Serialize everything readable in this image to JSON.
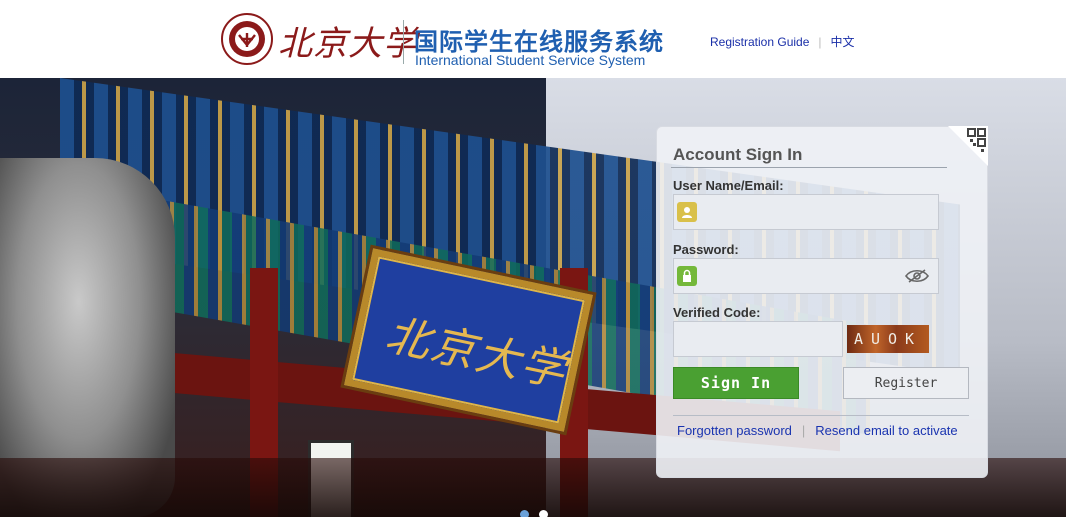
{
  "header": {
    "logo_script": "北京大学",
    "system_title_cn": "国际学生在线服务系统",
    "system_title_en": "International Student Service System",
    "links": [
      {
        "label": "Registration Guide"
      },
      {
        "label": "中文"
      }
    ]
  },
  "hero": {
    "plaque_text": "北京大学"
  },
  "login": {
    "title": "Account Sign In",
    "username_label": "User Name/Email:",
    "username_value": "",
    "password_label": "Password:",
    "password_value": "",
    "code_label": "Verified Code:",
    "code_value": "",
    "captcha_text": "AUOK",
    "signin_label": "Sign In",
    "register_label": "Register",
    "forgot_link": "Forgotten password",
    "resend_link": "Resend email to activate"
  },
  "colors": {
    "brand_red": "#8b1a1a",
    "title_blue": "#1f5fb0",
    "signin_green": "#4aa032",
    "link_blue": "#1a34b0"
  },
  "icons": [
    "seal-logo-icon",
    "user-icon",
    "lock-icon",
    "eye-icon",
    "qr-code-icon"
  ]
}
